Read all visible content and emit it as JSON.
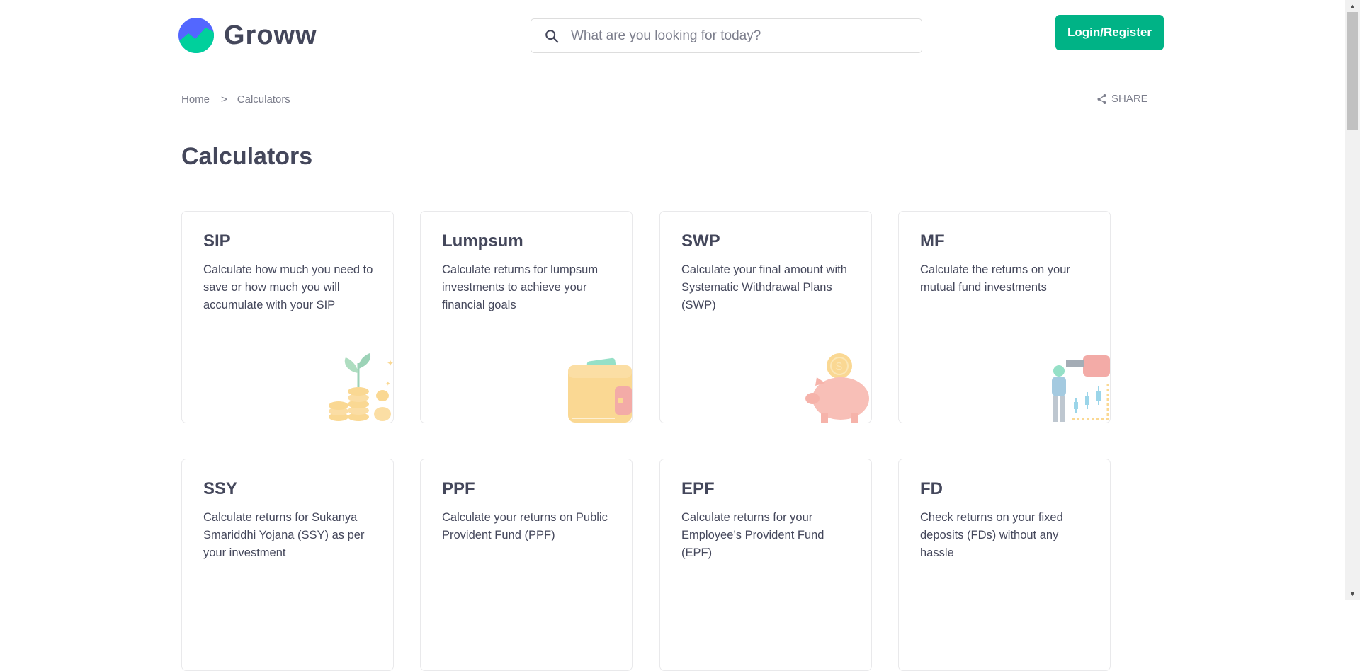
{
  "header": {
    "brand": "Groww",
    "search_placeholder": "What are you looking for today?",
    "login_label": "Login/Register"
  },
  "breadcrumb": {
    "home": "Home",
    "separator": ">",
    "current": "Calculators"
  },
  "share_label": "SHARE",
  "page_title": "Calculators",
  "cards": [
    {
      "title": "SIP",
      "desc": "Calculate how much you need to save or how much you will accumulate with your SIP",
      "icon": "coins-plant-icon"
    },
    {
      "title": "Lumpsum",
      "desc": "Calculate returns for lumpsum investments to achieve your financial goals",
      "icon": "wallet-icon"
    },
    {
      "title": "SWP",
      "desc": "Calculate your final amount with Systematic Withdrawal Plans (SWP)",
      "icon": "piggy-bank-icon"
    },
    {
      "title": "MF",
      "desc": "Calculate the returns on your mutual fund investments",
      "icon": "investor-chart-icon"
    },
    {
      "title": "SSY",
      "desc": "Calculate returns for Sukanya Smariddhi Yojana (SSY) as per your investment",
      "icon": ""
    },
    {
      "title": "PPF",
      "desc": "Calculate your returns on Public Provident Fund (PPF)",
      "icon": ""
    },
    {
      "title": "EPF",
      "desc": "Calculate returns for your Employee’s Provident Fund (EPF)",
      "icon": ""
    },
    {
      "title": "FD",
      "desc": "Check returns on your fixed deposits (FDs) without any hassle",
      "icon": ""
    }
  ],
  "colors": {
    "brand_green": "#00b386",
    "logo_blue": "#5367ff",
    "text_dark": "#44475b",
    "text_muted": "#7c7e8c"
  }
}
